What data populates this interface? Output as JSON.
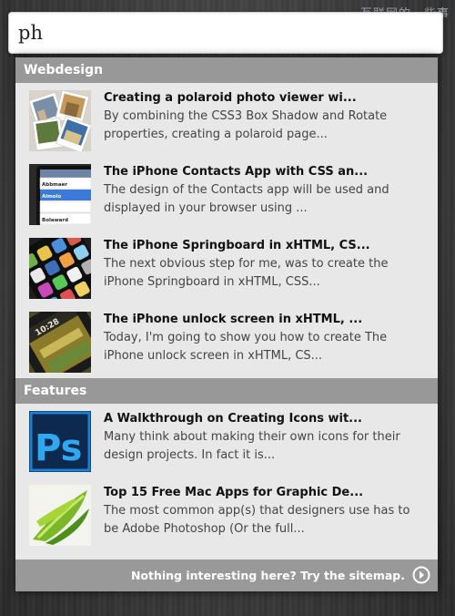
{
  "watermark": "互联网的一些事",
  "search": {
    "value": "ph",
    "placeholder": ""
  },
  "categories": [
    {
      "label": "Webdesign",
      "items": [
        {
          "title": "Creating a polaroid photo viewer wi...",
          "desc_line1": "By combining the CSS3 Box Shadow and Rotate",
          "desc_line2": "properties, creating a polaroid page...",
          "thumb": "polaroid-photos"
        },
        {
          "title": "The iPhone Contacts App with CSS an...",
          "desc_line1": "The design of the Contacts app will be used and",
          "desc_line2": "displayed in your browser using ...",
          "thumb": "iphone-contacts",
          "thumb_text": [
            "Abbmaer",
            "Almolo",
            "Bolaward"
          ]
        },
        {
          "title": "The iPhone Springboard in xHTML, CS...",
          "desc_line1": "The next obvious step for me, was to create the",
          "desc_line2": "iPhone Springboard in xHTML, CSS...",
          "thumb": "iphone-springboard"
        },
        {
          "title": "The iPhone unlock screen in xHTML, ...",
          "desc_line1": "Today, I'm going to show you how to create The",
          "desc_line2": "iPhone unlock screen in xHTML, CS...",
          "thumb": "iphone-unlock",
          "thumb_text": "10:28"
        }
      ]
    },
    {
      "label": "Features",
      "items": [
        {
          "title": "A Walkthrough on Creating Icons wit...",
          "desc_line1": "Many think about making their own icons for their",
          "desc_line2": "design projects. In fact it is...",
          "thumb": "photoshop-icon",
          "thumb_text": "Ps"
        },
        {
          "title": "Top 15 Free Mac Apps for Graphic De...",
          "desc_line1": "The most common app(s) that designers use has to",
          "desc_line2": "be Adobe Photoshop (Or the full...",
          "thumb": "green-leaf-art"
        }
      ]
    }
  ],
  "footer": {
    "link_text": "Nothing interesting here? Try the sitemap.",
    "icon": "arrow-right-circle-icon"
  },
  "colors": {
    "category_bar": "#989898",
    "panel": "#e8e8e8",
    "footer": "#999999",
    "text_title": "#111111",
    "text_desc": "#444444"
  }
}
